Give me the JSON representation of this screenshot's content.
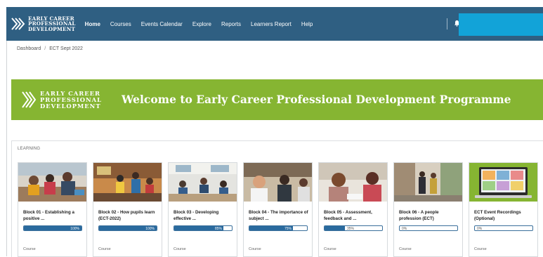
{
  "navbar": {
    "logo_lines": [
      "EARLY CAREER",
      "PROFESSIONAL",
      "DEVELOPMENT"
    ],
    "items": [
      {
        "label": "Home",
        "active": true
      },
      {
        "label": "Courses",
        "active": false
      },
      {
        "label": "Events Calendar",
        "active": false
      },
      {
        "label": "Explore",
        "active": false
      },
      {
        "label": "Reports",
        "active": false
      },
      {
        "label": "Learners Report",
        "active": false
      },
      {
        "label": "Help",
        "active": false
      }
    ],
    "icons": [
      "logo-chevron-icon",
      "bell-icon"
    ]
  },
  "breadcrumb": {
    "items": [
      "Dashboard",
      "ECT Sept 2022"
    ],
    "separator": "/"
  },
  "banner": {
    "logo_lines": [
      "EARLY CAREER",
      "PROFESSIONAL",
      "DEVELOPMENT"
    ],
    "title": "Welcome to Early Career Professional Development Programme",
    "color": "#86b532"
  },
  "learning": {
    "label": "LEARNING",
    "courses": [
      {
        "title": "Block 01 - Establishing a positive ...",
        "progress": 100,
        "progress_label": "100%",
        "type": "Course"
      },
      {
        "title": "Block 02 - How pupils learn (ECT-2022)",
        "progress": 100,
        "progress_label": "100%",
        "type": "Course"
      },
      {
        "title": "Block 03 - Developing effective ...",
        "progress": 85,
        "progress_label": "85%",
        "type": "Course"
      },
      {
        "title": "Block 04 - The importance of subject ...",
        "progress": 75,
        "progress_label": "75%",
        "type": "Course"
      },
      {
        "title": "Block 05 - Assessment, feedback and ...",
        "progress": 35,
        "progress_label": "35%",
        "type": "Course"
      },
      {
        "title": "Block 06 - A people profession (ECT)",
        "progress": 0,
        "progress_label": "0%",
        "type": "Course"
      },
      {
        "title": "ECT Event Recordings (Optional)",
        "progress": 0,
        "progress_label": "0%",
        "type": "Course"
      }
    ]
  },
  "colors": {
    "navbar": "#2f5f82",
    "accent_green": "#86b532",
    "progress": "#2a6a9e",
    "user_block": "#12a3d8"
  }
}
